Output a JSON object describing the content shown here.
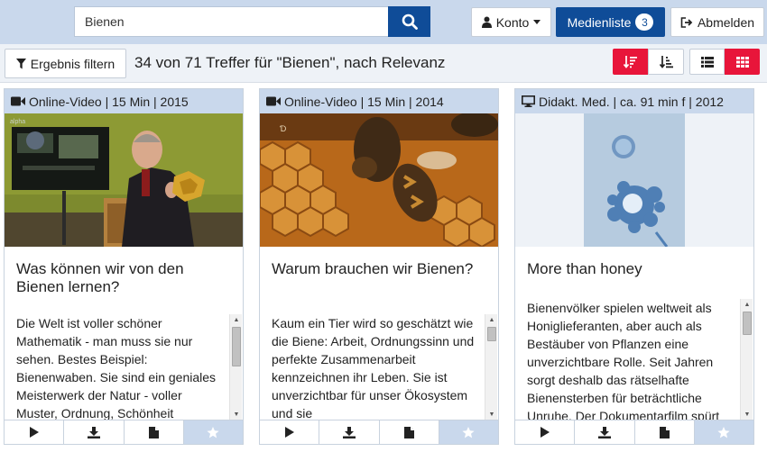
{
  "search": {
    "value": "Bienen"
  },
  "header": {
    "konto_label": "Konto",
    "medienliste_label": "Medienliste",
    "medienliste_count": "3",
    "abmelden_label": "Abmelden"
  },
  "toolbar": {
    "filter_label": "Ergebnis filtern",
    "result_text": "34 von 71 Treffer für \"Bienen\", nach Relevanz"
  },
  "colors": {
    "primary": "#0f4c98",
    "accent": "#e8153a",
    "header_bg": "#c9d8ec"
  },
  "cards": [
    {
      "meta": "Online-Video | 15 Min | 2015",
      "meta_icon": "video-camera-icon",
      "title": "Was können wir von den Bienen lernen?",
      "description": "Die Welt ist voller schöner Mathematik - man muss sie nur sehen. Bestes Beispiel: Bienenwaben. Sie sind ein geniales Meisterwerk der Natur - voller Muster, Ordnung, Schönheit"
    },
    {
      "meta": "Online-Video | 15 Min | 2014",
      "meta_icon": "video-camera-icon",
      "title": "Warum brauchen wir Bienen?",
      "description": "Kaum ein Tier wird so geschätzt wie die Biene: Arbeit, Ordnungssinn und perfekte Zusammenarbeit kennzeichnen ihr Leben. Sie ist unverzichtbar für unser Ökosystem und sie"
    },
    {
      "meta": "Didakt. Med. | ca. 91 min f | 2012",
      "meta_icon": "monitor-icon",
      "title": "More than honey",
      "description": "Bienenvölker spielen weltweit als Honiglieferanten, aber auch als Bestäuber von Pflanzen eine unverzichtbare Rolle. Seit Jahren sorgt deshalb das rätselhafte Bienensterben für beträchtliche Unruhe. Der Dokumentarfilm spürt"
    }
  ],
  "card_actions": [
    "play-icon",
    "download-icon",
    "document-icon",
    "star-icon"
  ]
}
